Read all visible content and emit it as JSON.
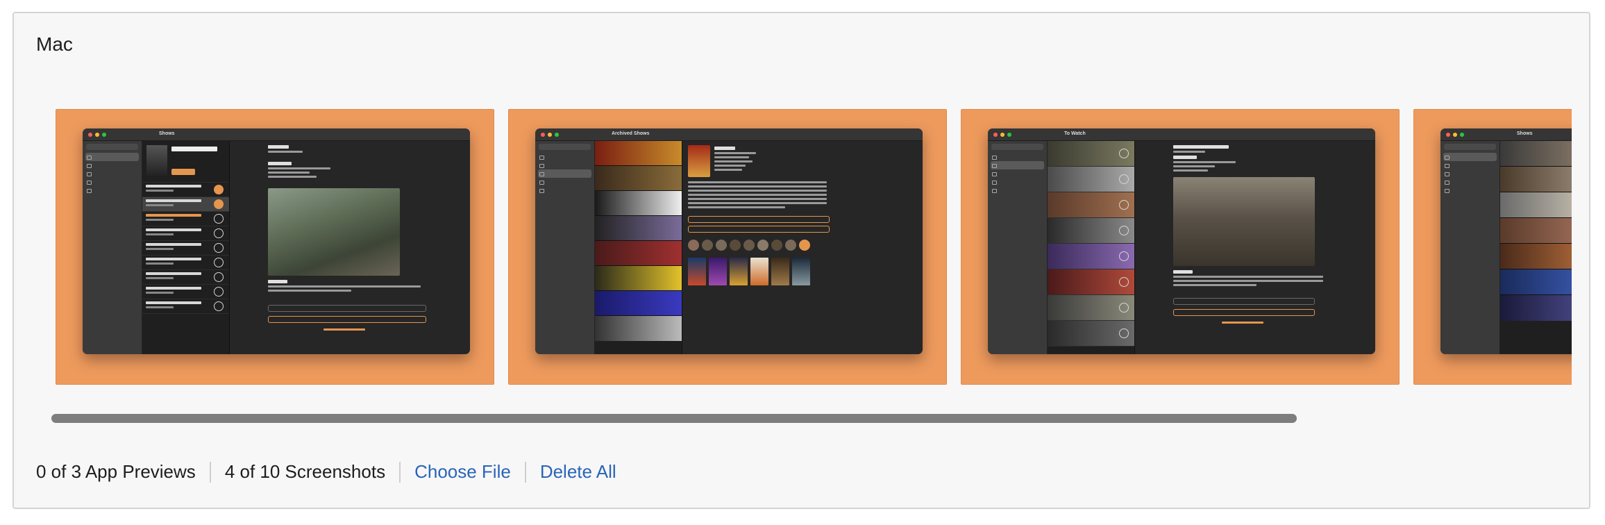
{
  "platform": {
    "title": "Mac"
  },
  "carousel": {
    "screenshots": [
      {
        "window_title": "Shows",
        "accent": "#ee9a5d"
      },
      {
        "window_title": "Archived Shows",
        "accent": "#ee9a5d"
      },
      {
        "window_title": "To Watch",
        "accent": "#ee9a5d"
      },
      {
        "window_title": "Shows",
        "accent": "#ee9a5d"
      }
    ],
    "scroll_progress": 0.0
  },
  "footer": {
    "previews_count": "0 of 3 App Previews",
    "screenshots_count": "4 of 10 Screenshots",
    "choose_file": "Choose File",
    "delete_all": "Delete All"
  },
  "colors": {
    "thumb_background": "#ee9a5d",
    "link": "#2965b8",
    "text": "#1d1d1f",
    "scrollbar": "#7d7d7d"
  }
}
